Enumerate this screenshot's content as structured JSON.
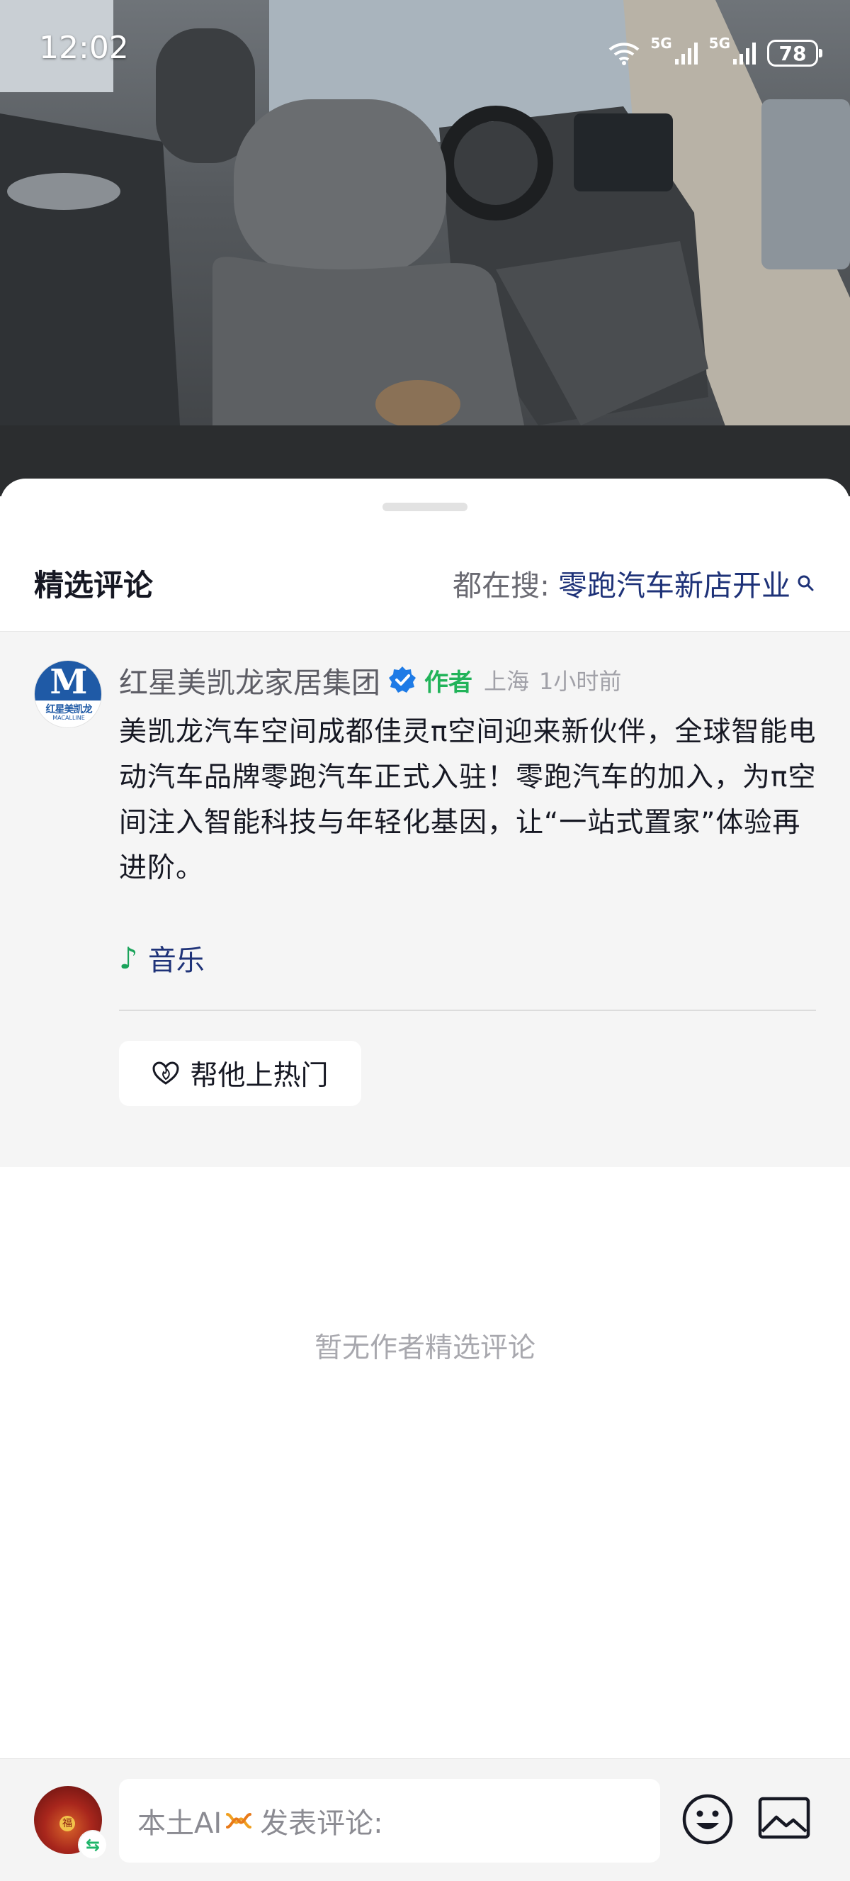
{
  "status_bar": {
    "time": "12:02",
    "network_1": "5G",
    "network_2": "5G",
    "battery": "78"
  },
  "comments_sheet": {
    "title": "精选评论",
    "search_prefix": "都在搜:",
    "search_term": "零跑汽车新店开业"
  },
  "post": {
    "author_name": "红星美凯龙家居集团",
    "author_avatar_letter": "M",
    "author_avatar_text": "红星美凯龙",
    "author_avatar_subtext": "MACALLINE",
    "author_tag": "作者",
    "location": "上海",
    "time_ago": "1小时前",
    "text": "美凯龙汽车空间成都佳灵π空间迎来新伙伴，全球智能电动汽车品牌零跑汽车正式入驻！零跑汽车的加入，为π空间注入智能科技与年轻化基因，让“一站式置家”体验再进阶。",
    "music_label": "音乐",
    "boost_label": "帮他上热门"
  },
  "empty_hint": "暂无作者精选评论",
  "input_bar": {
    "ai_label": "本土AI",
    "placeholder": "发表评论:"
  },
  "colors": {
    "accent_green": "#21b359",
    "search_term_blue": "#1e3278",
    "verified_blue": "#1e7be6"
  }
}
